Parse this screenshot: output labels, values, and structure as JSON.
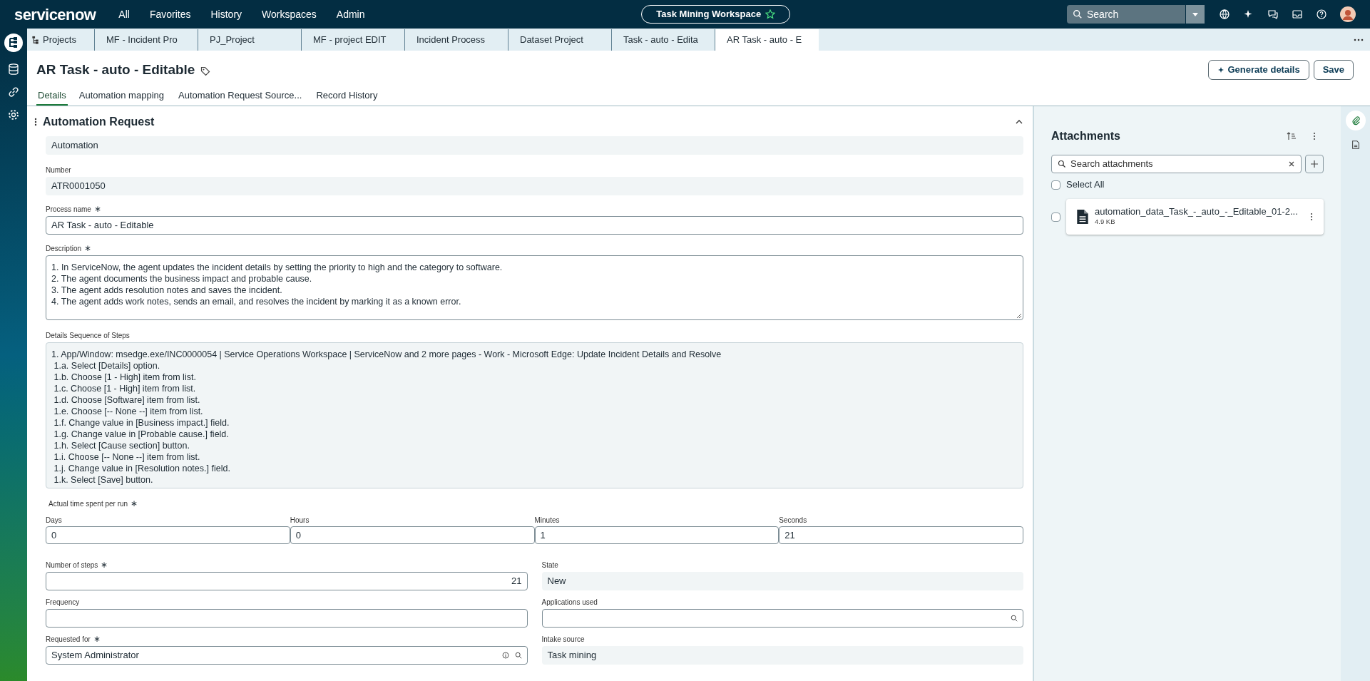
{
  "top_nav": {
    "logo": "servicenow",
    "menu": [
      "All",
      "Favorites",
      "History",
      "Workspaces",
      "Admin"
    ],
    "workspace": "Task Mining Workspace",
    "search": "Search"
  },
  "tabs": [
    {
      "label": "Projects",
      "selected": false
    },
    {
      "label": "MF - Incident Pro",
      "selected": false
    },
    {
      "label": "PJ_Project",
      "selected": false
    },
    {
      "label": "MF - project EDIT",
      "selected": false
    },
    {
      "label": "Incident Process",
      "selected": false
    },
    {
      "label": "Dataset Project",
      "selected": false
    },
    {
      "label": "Task - auto - Edita",
      "selected": false
    },
    {
      "label": "AR Task - auto - E",
      "selected": true
    }
  ],
  "record": {
    "title": "AR Task - auto - Editable",
    "generate": "Generate details",
    "save": "Save"
  },
  "subtabs": [
    {
      "label": "Details",
      "selected": true
    },
    {
      "label": "Automation mapping",
      "selected": false
    },
    {
      "label": "Automation Request Source...",
      "selected": false
    },
    {
      "label": "Record History",
      "selected": false
    }
  ],
  "section": {
    "title": "Automation Request",
    "fields": [
      {
        "kind": "readonly",
        "value": "Automation"
      },
      {
        "kind": "readonly",
        "label": "Number",
        "value": "ATR0001050"
      },
      {
        "kind": "input",
        "label": "Process name",
        "required_mark": "∗",
        "value": "AR Task - auto - Editable"
      },
      {
        "kind": "textarea",
        "label": "Description",
        "required_mark": "∗",
        "lines": [
          "1. In ServiceNow, the agent updates the incident details by setting the priority to high and the category to software.",
          "2. The agent documents the business impact and probable cause.",
          "3. The agent adds resolution notes and saves the incident.",
          "4. The agent adds work notes, sends an email, and resolves the incident by marking it as a known error."
        ]
      },
      {
        "kind": "steps",
        "label": "Details Sequence of Steps",
        "lines": [
          "1. App/Window: msedge.exe/INC0000054 | Service Operations Workspace | ServiceNow and 2 more pages - Work - Microsoft Edge: Update Incident Details and Resolve",
          " 1.a. Select [Details] option.",
          " 1.b. Choose [1 - High] item from list.",
          " 1.c. Choose [1 - High] item from list.",
          " 1.d. Choose [Software] item from list.",
          " 1.e. Choose [-- None --] item from list.",
          " 1.f. Change value in [Business impact.] field.",
          " 1.g. Change value in [Probable cause.] field.",
          " 1.h. Select [Cause section] button.",
          " 1.i. Choose [-- None --] item from list.",
          " 1.j. Change value in [Resolution notes.] field.",
          " 1.k. Select [Save] button."
        ]
      }
    ],
    "time": {
      "label": "Actual time spent per run",
      "required_mark": "∗",
      "parts": [
        {
          "label": "Days",
          "value": "0"
        },
        {
          "label": "Hours",
          "value": "0"
        },
        {
          "label": "Minutes",
          "value": "1"
        },
        {
          "label": "Seconds",
          "value": "21"
        }
      ]
    },
    "grid": [
      {
        "kind": "number",
        "label": "Number of steps",
        "required_mark": "∗",
        "value": "21"
      },
      {
        "kind": "readonly",
        "label": "State",
        "value": "New"
      },
      {
        "kind": "input",
        "label": "Frequency"
      },
      {
        "kind": "lookup",
        "label": "Applications used"
      },
      {
        "kind": "reference",
        "label": "Requested for",
        "required_mark": "∗",
        "value": "System Administrator"
      },
      {
        "kind": "readonly",
        "label": "Intake source",
        "value": "Task mining"
      }
    ]
  },
  "attachments": {
    "title": "Attachments",
    "search_placeholder": "Search attachments",
    "select_all": {
      "label": "Select All",
      "checked": false
    },
    "files": [
      {
        "name": "automation_data_Task_-_auto_-_Editable_01-2...",
        "size": "4.9 KB",
        "checked": false
      }
    ]
  },
  "right_rail": [
    {
      "kind": "attachment",
      "selected": true
    },
    {
      "kind": "document",
      "selected": false
    }
  ]
}
